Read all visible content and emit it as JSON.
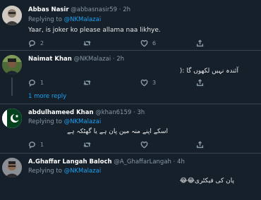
{
  "tweets": [
    {
      "name": "Abbas Nasir",
      "handle": "@abbasnasir59",
      "time": "2h",
      "replying_label": "Replying to",
      "replying_to": "@NKMalazai",
      "text": "Yaar, is joker ko please allama naa likhye.",
      "replies": "2",
      "retweets": "",
      "likes": "6"
    },
    {
      "name": "Naimat Khan",
      "handle": "@NKMalazai",
      "time": "2h",
      "text": "آئندہ نہیں لکھوں گا :(",
      "replies": "1",
      "retweets": "",
      "likes": "3",
      "more_replies": "1 more reply"
    },
    {
      "name": "abdulhameed Khan",
      "handle": "@khan6159",
      "time": "3h",
      "replying_label": "Replying to",
      "replying_to": "@NKMalazai",
      "text": "اسکے اپنے منہ مین پان ہے یا گھٹکہ ہے",
      "replies": "1",
      "retweets": "",
      "likes": ""
    },
    {
      "name": "A.Ghaffar Langah Baloch",
      "handle": "@A_GhaffarLangah",
      "time": "4h",
      "replying_label": "Replying to",
      "replying_to": "@NKMalazai",
      "text": "پان کی فیکٹری😂😂"
    }
  ],
  "icons": [
    "reply-icon",
    "retweet-icon",
    "like-icon",
    "share-icon"
  ],
  "colors": {
    "background": "#15202b",
    "accent": "#1da1f2",
    "muted": "#8899a6",
    "divider": "#38444d"
  }
}
